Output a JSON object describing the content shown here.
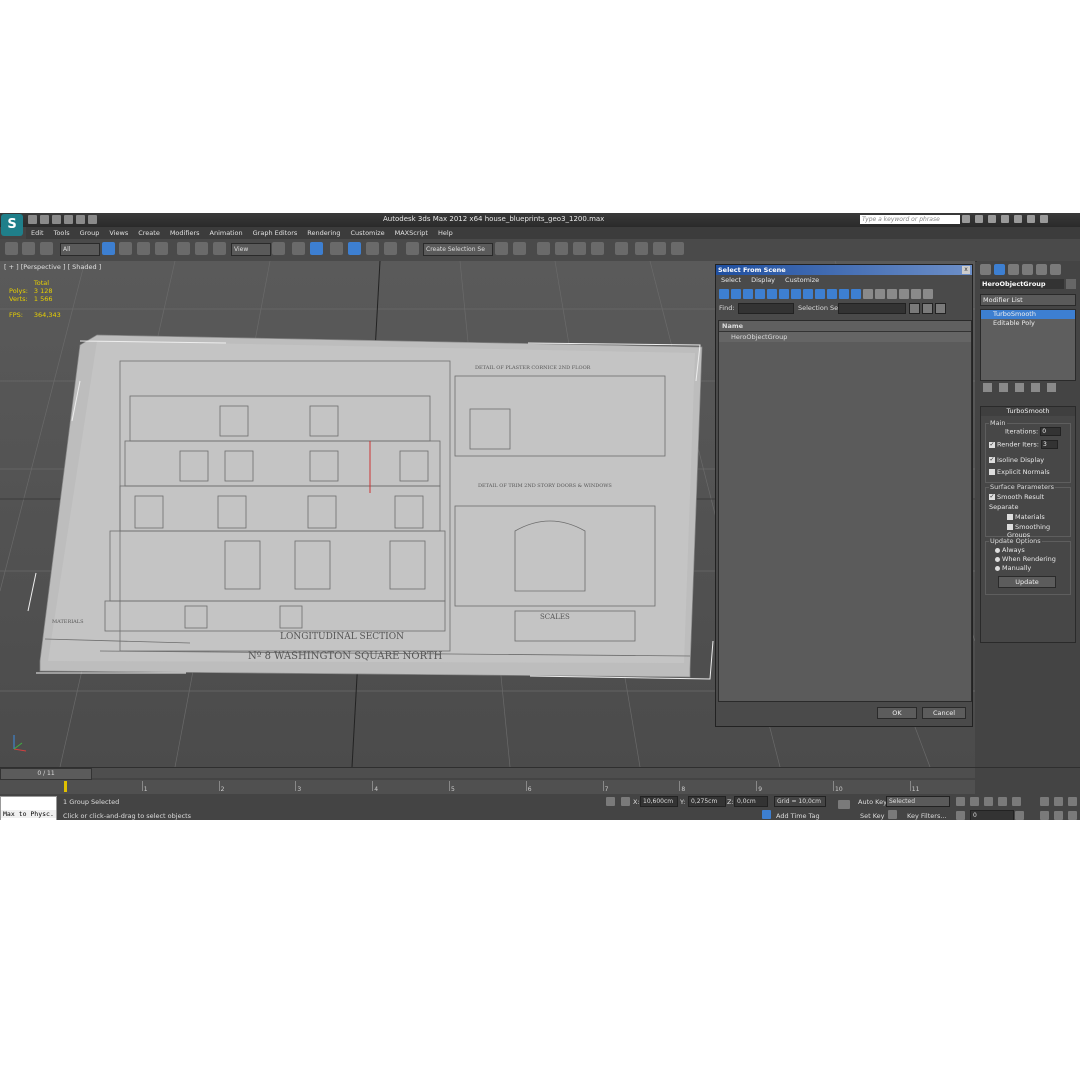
{
  "app": {
    "title": "Autodesk 3ds Max  2012 x64     house_blueprints_geo3_1200.max",
    "search_placeholder": "Type a keyword or phrase",
    "logo_letter": "S"
  },
  "menu": [
    "Edit",
    "Tools",
    "Group",
    "Views",
    "Create",
    "Modifiers",
    "Animation",
    "Graph Editors",
    "Rendering",
    "Customize",
    "MAXScript",
    "Help"
  ],
  "toolbar": {
    "filter": "All",
    "ref_coord": "View",
    "selection_set": "Create Selection Se"
  },
  "viewport": {
    "label": "[ + ] [Perspective ] [ Shaded ]",
    "stats": {
      "header": "Total",
      "polys_label": "Polys:",
      "polys_value": "3 128",
      "verts_label": "Verts:",
      "verts_value": "1 566",
      "fps_label": "FPS:",
      "fps_value": "364,343"
    },
    "blueprint": {
      "title": "LONGITUDINAL SECTION",
      "subtitle": "Nº 8 WASHINGTON SQUARE NORTH",
      "scales": "SCALES",
      "detail1": "DETAIL OF PLASTER CORNICE 2ND FLOOR",
      "detail2": "DETAIL OF TRIM 2ND STORY DOORS & WINDOWS",
      "materials": "MATERIALS"
    }
  },
  "command_panel": {
    "object_name": "HeroObjectGroup",
    "modifier_list": "Modifier List",
    "stack": [
      {
        "label": "TurboSmooth",
        "selected": true
      },
      {
        "label": "Editable Poly",
        "selected": false
      }
    ],
    "rollout": {
      "title": "TurboSmooth",
      "main_group": "Main",
      "iterations_label": "Iterations:",
      "iterations_value": "0",
      "render_iters_label": "Render Iters:",
      "render_iters_value": "3",
      "isoline_display": "Isoline Display",
      "explicit_normals": "Explicit Normals",
      "surface_group": "Surface Parameters",
      "smooth_result": "Smooth Result",
      "separate_label": "Separate",
      "materials": "Materials",
      "smoothing_groups": "Smoothing Groups",
      "update_group": "Update Options",
      "always": "Always",
      "when_rendering": "When Rendering",
      "manually": "Manually",
      "update_button": "Update"
    }
  },
  "dialog": {
    "title": "Select From Scene",
    "close": "x",
    "menu": [
      "Select",
      "Display",
      "Customize"
    ],
    "find_label": "Find:",
    "selection_set_label": "Selection Set:",
    "column_name": "Name",
    "items": [
      "HeroObjectGroup"
    ],
    "ok": "OK",
    "cancel": "Cancel"
  },
  "status": {
    "time_slider": "0 / 11",
    "ticks": [
      "1",
      "2",
      "3",
      "4",
      "5",
      "6",
      "7",
      "8",
      "9",
      "10",
      "11"
    ],
    "maxscript_listener": "Max to Physc.",
    "selection_info": "1 Group Selected",
    "prompt": "Click or click-and-drag to select objects",
    "x_label": "X:",
    "x_value": "10,600cm",
    "y_label": "Y:",
    "y_value": "0,275cm",
    "z_label": "Z:",
    "z_value": "0,0cm",
    "grid": "Grid = 10,0cm",
    "add_time_tag": "Add Time Tag",
    "auto_key": "Auto Key",
    "set_key": "Set Key",
    "key_mode": "Selected",
    "key_filters": "Key Filters...",
    "frame": "0"
  }
}
